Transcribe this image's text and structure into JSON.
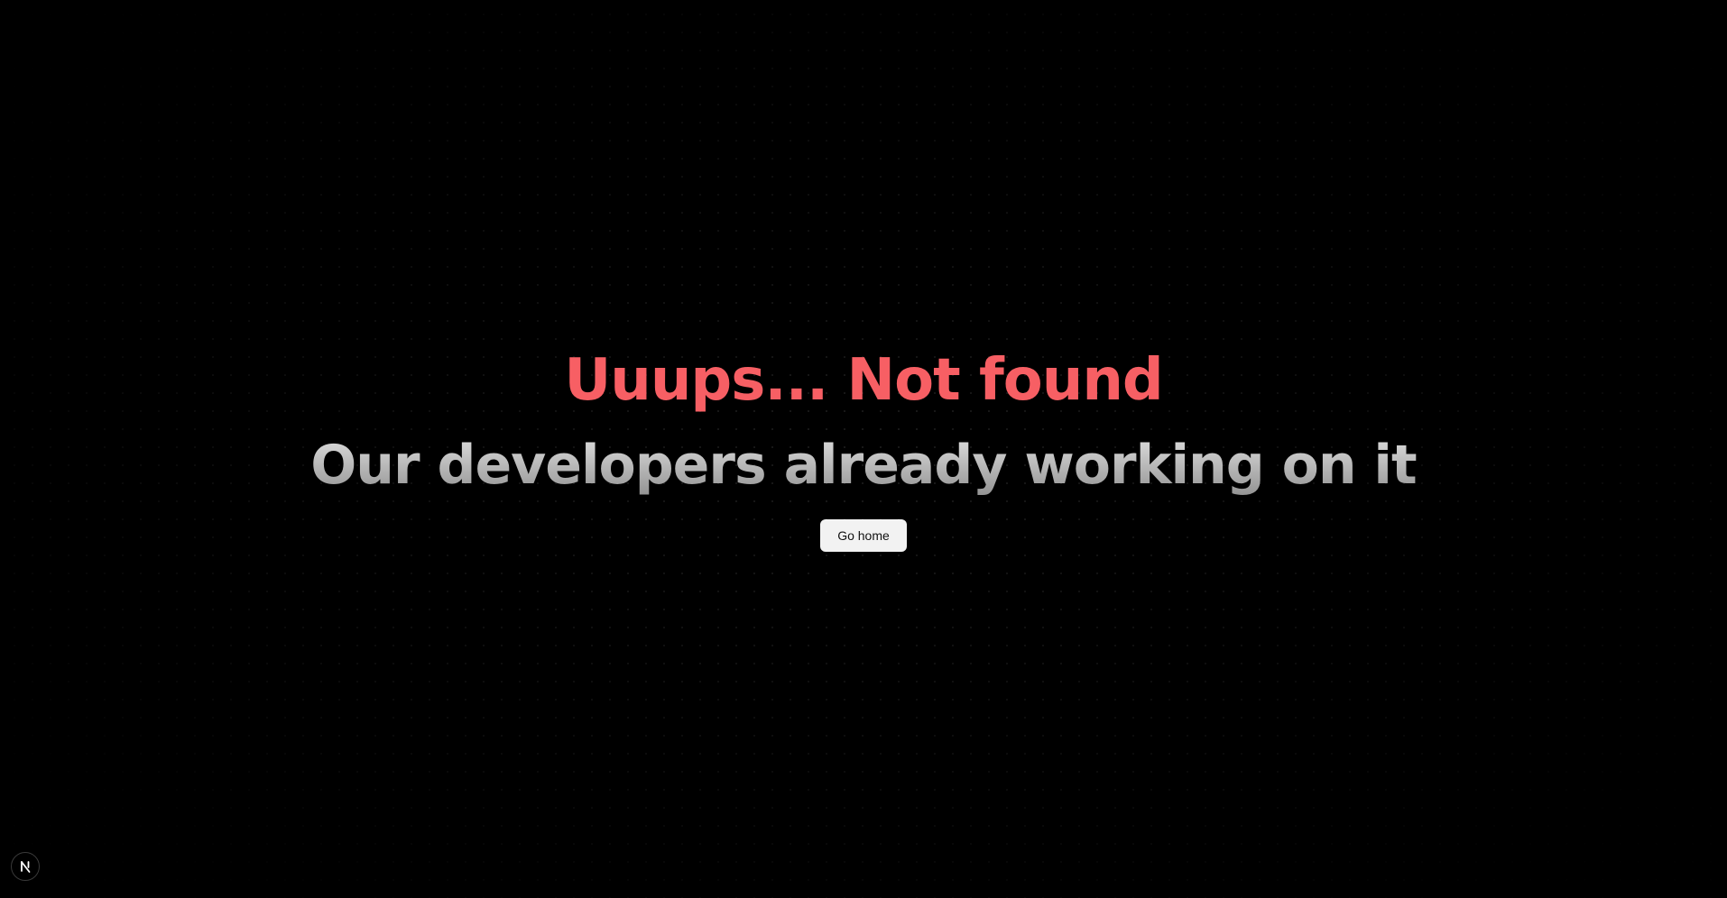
{
  "page": {
    "headline": "Uuups... Not found",
    "subline": "Our developers already working on it",
    "button_label": "Go home"
  },
  "colors": {
    "background": "#000000",
    "headline": "#f75f64",
    "subline_top": "#e6e6e6",
    "subline_bottom": "#8c8c8c",
    "button_bg": "#f2f2f2",
    "button_text": "#111111"
  },
  "icons": {
    "dev_badge": "nextjs-icon"
  }
}
